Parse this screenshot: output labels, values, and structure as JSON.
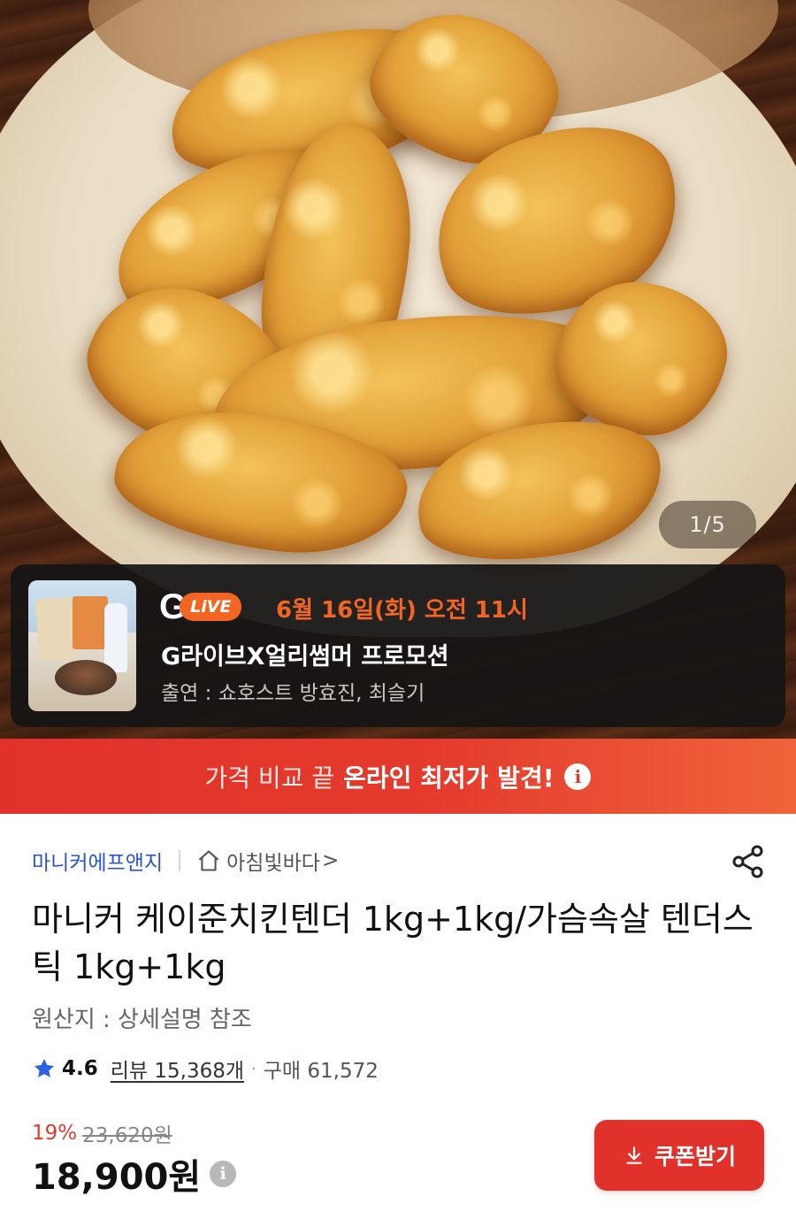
{
  "hero": {
    "image": "fried-chicken-tenders-photo",
    "slide_counter": "1/5"
  },
  "live": {
    "logo_letter": "G",
    "logo_badge": "LiVE",
    "date": "6월 16일(화) 오전 11시",
    "title": "G라이브X얼리썸머 프로모션",
    "cast": "출연 : 쇼호스트 방효진, 최슬기"
  },
  "banner": {
    "prefix": "가격 비교 끝",
    "highlight": "온라인 최저가 발견!",
    "info_glyph": "i"
  },
  "product": {
    "brand": "마니커에프앤지",
    "store": "아침빛바다",
    "store_chevron": ">",
    "title": "마니커 케이준치킨텐더 1kg+1kg/가슴속살 텐더스틱 1kg+1kg",
    "origin": "원산지 : 상세설명 참조",
    "rating": "4.6",
    "reviews": "리뷰 15,368개",
    "separator": "·",
    "purchases": "구매 61,572",
    "discount": "19%",
    "original_price": "23,620원",
    "price": "18,900원",
    "price_info_glyph": "i",
    "coupon_label": "쿠폰받기"
  },
  "colors": {
    "accent_red": "#e1312b",
    "live_orange": "#f26522",
    "brand_blue": "#2b57c8",
    "star_blue": "#2b63e0"
  }
}
